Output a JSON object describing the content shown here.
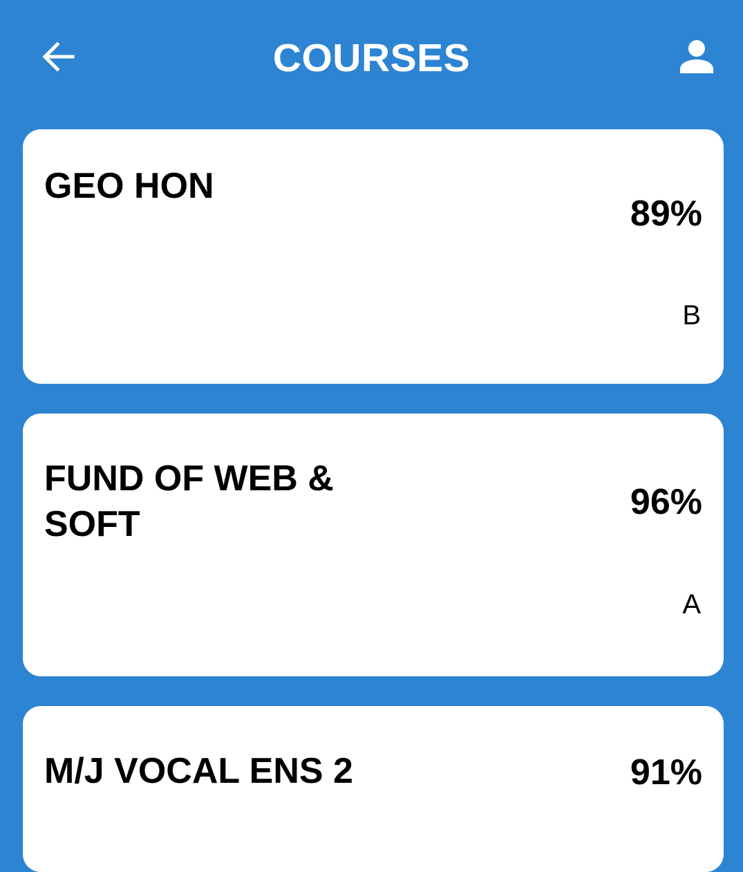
{
  "header": {
    "title": "COURSES",
    "back_icon": "arrow-left-icon",
    "profile_icon": "person-icon"
  },
  "colors": {
    "background": "#2c84d3",
    "card": "#ffffff",
    "text": "#000000",
    "header_text": "#ffffff"
  },
  "courses": [
    {
      "name": "GEO HON",
      "percent": "89%",
      "letter": "B"
    },
    {
      "name": "FUND OF WEB & SOFT",
      "percent": "96%",
      "letter": "A"
    },
    {
      "name": "M/J VOCAL ENS 2",
      "percent": "91%",
      "letter": ""
    }
  ]
}
